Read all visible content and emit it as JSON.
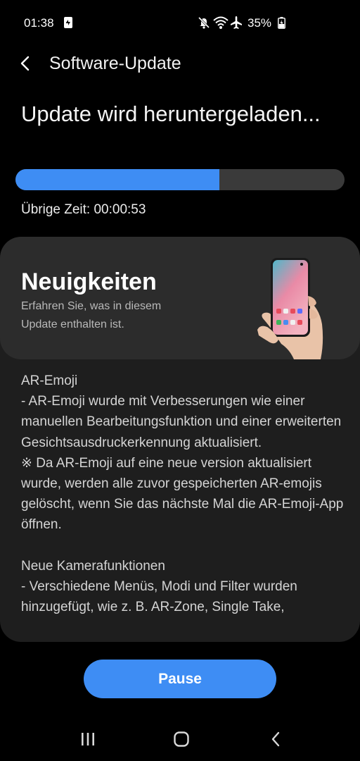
{
  "status_bar": {
    "time": "01:38",
    "battery": "35%",
    "icons": [
      "sim-swap-icon",
      "mute-icon",
      "wifi-icon",
      "airplane-icon",
      "battery-charging-icon"
    ]
  },
  "app_bar": {
    "title": "Software-Update",
    "back_icon": "back-arrow-icon"
  },
  "download": {
    "heading": "Update wird heruntergeladen...",
    "progress_percent": 62,
    "remaining_time": "Übrige Zeit: 00:00:53"
  },
  "news": {
    "title": "Neuigkeiten",
    "description": "Erfahren Sie, was in diesem Update enthalten ist.",
    "image": "phone-in-hand-illustration"
  },
  "release_notes": [
    "AR-Emoji",
    "- AR-Emoji wurde mit Verbesserungen wie einer manuellen Bearbeitungsfunktion und einer erweiterten Gesichtsausdruckerkennung aktualisiert.",
    "※ Da AR-Emoji auf eine neue version aktualisiert wurde, werden alle zuvor gespeicherten AR-emojis gelöscht, wenn Sie das nächste Mal die AR-Emoji-App öffnen.",
    "",
    "Neue Kamerafunktionen",
    "- Verschiedene Menüs, Modi und Filter wurden hinzugefügt, wie z. B. AR-Zone, Single Take,"
  ],
  "actions": {
    "pause_label": "Pause"
  },
  "nav_bar": {
    "recents_icon": "recent-apps-icon",
    "home_icon": "home-icon",
    "back_icon": "back-icon"
  },
  "colors": {
    "accent": "#3e8df4",
    "background": "#000000",
    "panel": "#1e1e1e",
    "card": "#2c2c2c",
    "track": "#3a3a3a"
  }
}
